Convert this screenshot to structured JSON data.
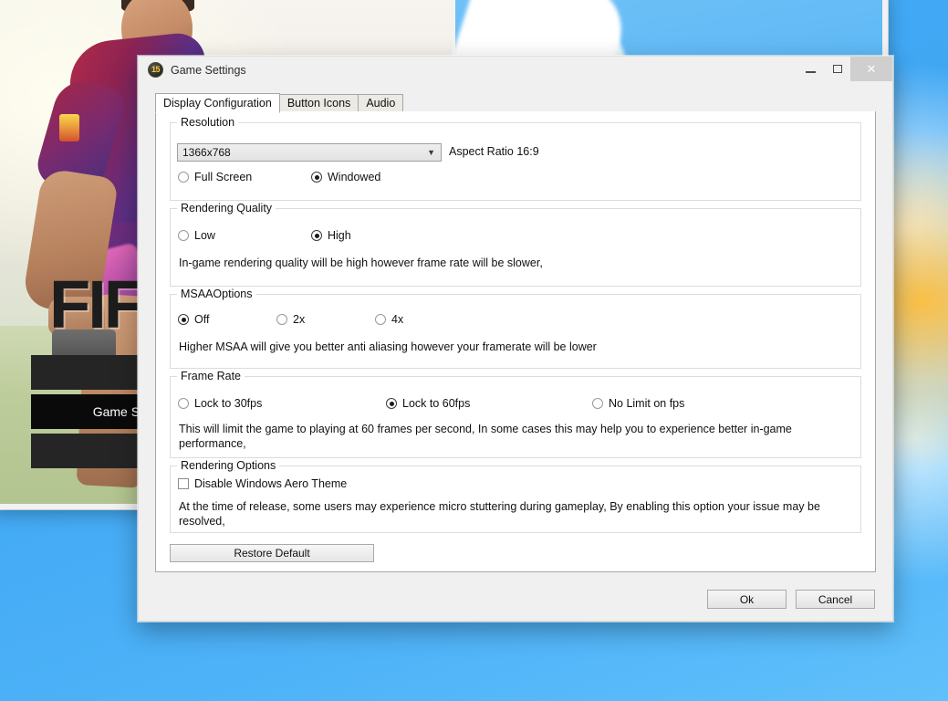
{
  "desktop": {
    "wallpaper_color": "#3fa9f5",
    "accent_orange": "#ffbe3c"
  },
  "launcher": {
    "logo_text": "FIFA",
    "buttons": [
      {
        "label": ""
      },
      {
        "label": "Game Settings"
      },
      {
        "label": ""
      }
    ]
  },
  "window": {
    "title": "Game Settings",
    "icon": "fifa-15-icon",
    "icon_text": "15",
    "controls": {
      "minimize": "–",
      "maximize": "❐",
      "close": "✕"
    }
  },
  "tabs": [
    {
      "label": "Display Configuration",
      "active": true
    },
    {
      "label": "Button Icons",
      "active": false
    },
    {
      "label": "Audio",
      "active": false
    }
  ],
  "display_configuration": {
    "resolution": {
      "legend": "Resolution",
      "selected": "1366x768",
      "options": [
        "1366x768"
      ],
      "dropdown_icon": "chevron-down-icon",
      "aspect_ratio_label": "Aspect Ratio 16:9",
      "modes": [
        {
          "label": "Full Screen",
          "selected": false
        },
        {
          "label": "Windowed",
          "selected": true
        }
      ]
    },
    "rendering_quality": {
      "legend": "Rendering Quality",
      "options": [
        {
          "label": "Low",
          "selected": false
        },
        {
          "label": "High",
          "selected": true
        }
      ],
      "description": "In-game rendering quality will be high however frame rate will be slower,"
    },
    "msaa": {
      "legend": "MSAAOptions",
      "options": [
        {
          "label": "Off",
          "selected": true
        },
        {
          "label": "2x",
          "selected": false
        },
        {
          "label": "4x",
          "selected": false
        }
      ],
      "description": "Higher MSAA will give you better anti aliasing however your framerate will be lower"
    },
    "frame_rate": {
      "legend": "Frame Rate",
      "options": [
        {
          "label": "Lock  to 30fps",
          "selected": false
        },
        {
          "label": "Lock to 60fps",
          "selected": true
        },
        {
          "label": "No Limit on fps",
          "selected": false
        }
      ],
      "description": "This will limit the game to playing at 60 frames per second, In some cases this may help you to experience better in-game performance,"
    },
    "rendering_options": {
      "legend": "Rendering Options",
      "checkbox": {
        "label": "Disable Windows Aero Theme",
        "checked": false
      },
      "description": "At the time of release, some users may experience micro stuttering during gameplay, By enabling this option your issue may be resolved,"
    },
    "restore_default_label": "Restore Default"
  },
  "footer": {
    "ok_label": "Ok",
    "cancel_label": "Cancel"
  }
}
